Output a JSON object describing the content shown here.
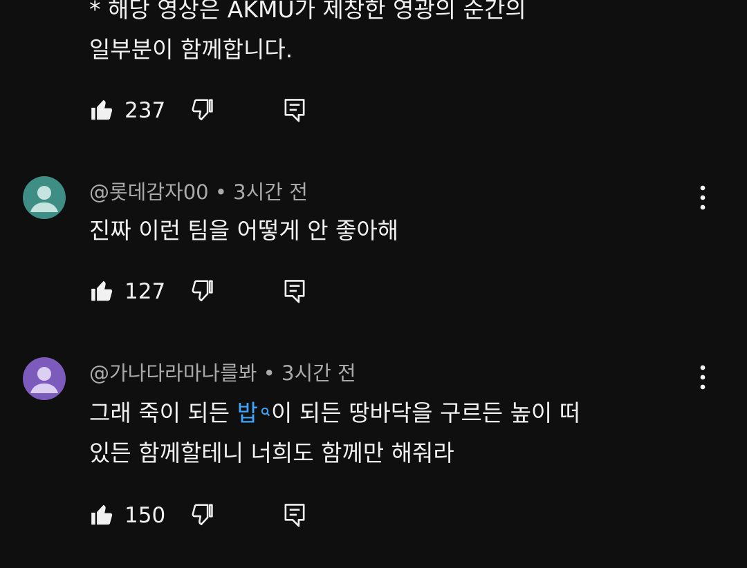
{
  "top_comment": {
    "line1": "* 해당 영상은 AKMU가 제창한 영광의 순간의",
    "line2": "일부분이 함께합니다.",
    "likes": "237"
  },
  "comments": [
    {
      "author": "@롯데감자00",
      "separator": "•",
      "time": "3시간 전",
      "line1": "진짜 이런 팀을 어떻게 안 좋아해",
      "likes": "127",
      "avatar_color": "#3f8e86"
    },
    {
      "author": "@가나다라마나를봐",
      "separator": "•",
      "time": "3시간 전",
      "line1_before": "그래 죽이 되든 ",
      "line1_link": "밥",
      "line1_after": "이 되든 땅바닥을 구르든 높이 떠",
      "line2": "있든 함께할테니 너희도 함께만 해줘라",
      "likes": "150",
      "avatar_color": "#7c5bbd"
    }
  ],
  "icons": {
    "like": "thumbs-up-icon",
    "dislike": "thumbs-down-icon",
    "reply": "reply-icon",
    "menu": "more-vert-icon",
    "search": "search-icon"
  },
  "colors": {
    "background": "#0f0f0f",
    "text": "#f1f1f1",
    "meta": "#aaaaaa",
    "link": "#3ea6ff"
  }
}
